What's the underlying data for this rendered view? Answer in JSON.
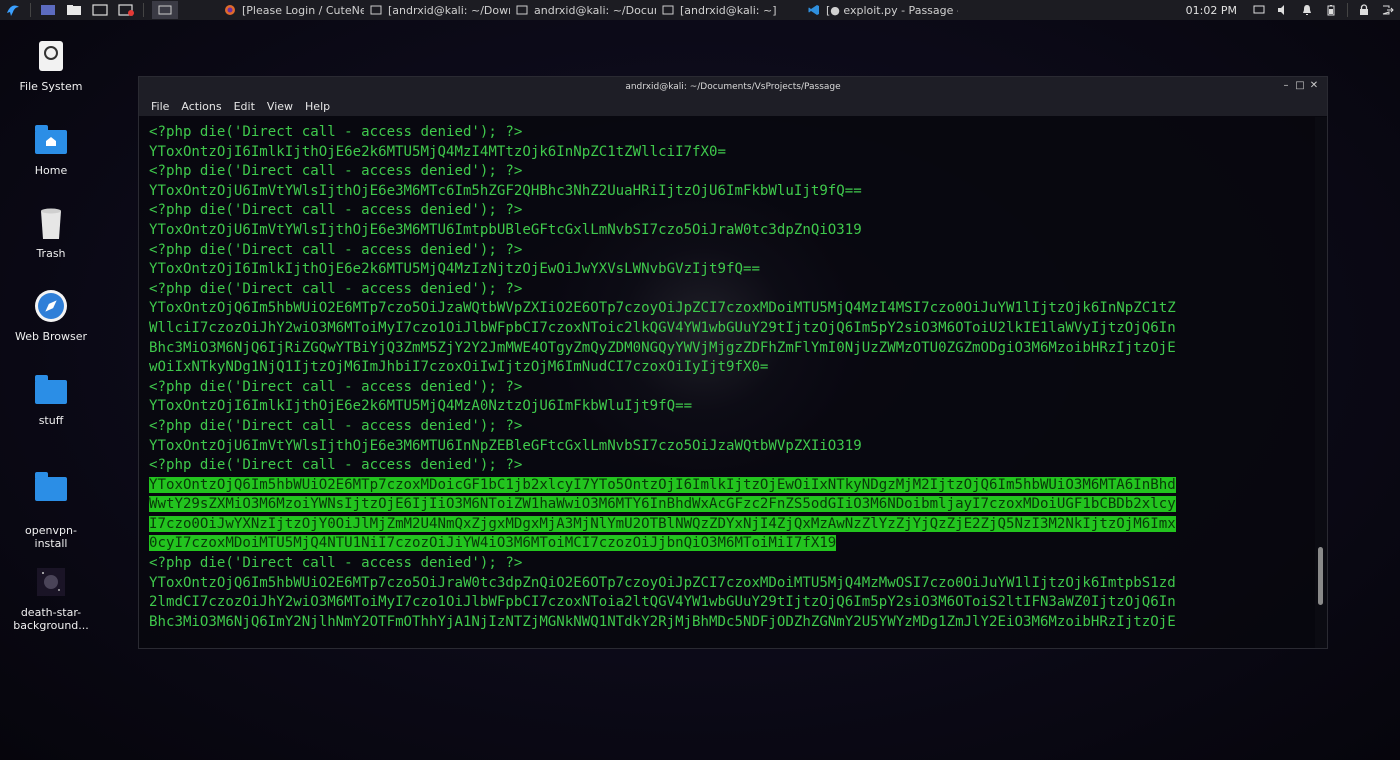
{
  "taskbar": {
    "tasks": [
      {
        "icon": "firefox-icon",
        "label": "[Please Login / CuteNew..."
      },
      {
        "icon": "terminal-icon",
        "label": "[andrxid@kali: ~/Downl..."
      },
      {
        "icon": "terminal-icon",
        "label": "andrxid@kali: ~/Docum..."
      },
      {
        "icon": "terminal-icon",
        "label": "[andrxid@kali: ~]"
      },
      {
        "icon": "vscode-icon",
        "label": "[● exploit.py - Passage - ..."
      }
    ],
    "clock": "01:02 PM"
  },
  "desktop": {
    "icons": [
      {
        "name": "File System",
        "icon": "drive-icon"
      },
      {
        "name": "Home",
        "icon": "home-folder-icon"
      },
      {
        "name": "Trash",
        "icon": "trash-icon"
      },
      {
        "name": "Web Browser",
        "icon": "compass-icon"
      },
      {
        "name": "stuff",
        "icon": "folder-icon"
      },
      {
        "name": "openvpn-\ninstall",
        "icon": "folder-icon"
      },
      {
        "name": "death-star-\nbackground...",
        "icon": "image-thumbnail-icon"
      }
    ]
  },
  "terminal": {
    "title": "andrxid@kali: ~/Documents/VsProjects/Passage",
    "menu": [
      "File",
      "Actions",
      "Edit",
      "View",
      "Help"
    ],
    "lines": [
      "<?php die('Direct call - access denied'); ?>",
      "YToxOntzOjI6ImlkIjthOjE6e2k6MTU5MjQ4MzI4MTtzOjk6InNpZC1tZWllciI7fX0=",
      "<?php die('Direct call - access denied'); ?>",
      "YToxOntzOjU6ImVtYWlsIjthOjE6e3M6MTc6Im5hZGF2QHBhc3NhZ2UuaHRiIjtzOjU6ImFkbWluIjt9fQ==",
      "<?php die('Direct call - access denied'); ?>",
      "YToxOntzOjU6ImVtYWlsIjthOjE6e3M6MTU6ImtpbUBleGFtcGxlLmNvbSI7czo5OiJraW0tc3dpZnQiO319",
      "<?php die('Direct call - access denied'); ?>",
      "YToxOntzOjI6ImlkIjthOjE6e2k6MTU5MjQ4MzIzNjtzOjEwOiJwYXVsLWNvbGVzIjt9fQ==",
      "<?php die('Direct call - access denied'); ?>",
      "YToxOntzOjQ6Im5hbWUiO2E6MTp7czo5OiJzaWQtbWVpZXIiO2E6OTp7czoyOiJpZCI7czoxMDoiMTU5MjQ4MzI4MSI7czo0OiJuYW1lIjtzOjk6InNpZC1tZ",
      "WllciI7czozOiJhY2wiO3M6MToiMyI7czo1OiJlbWFpbCI7czoxNToic2lkQGV4YW1wbGUuY29tIjtzOjQ6Im5pY2siO3M6OToiU2lkIE1laWVyIjtzOjQ6In",
      "Bhc3MiO3M6NjQ6IjRiZGQwYTBiYjQ3ZmM5ZjY2Y2JmMWE4OTgyZmQyZDM0NGQyYWVjMjgzZDFhZmFlYmI0NjUzZWMzOTU0ZGZmODgiO3M6MzoibHRzIjtzOjE",
      "wOiIxNTkyNDg1NjQ1IjtzOjM6ImJhbiI7czoxOiIwIjtzOjM6ImNudCI7czoxOiIyIjt9fX0=",
      "<?php die('Direct call - access denied'); ?>",
      "YToxOntzOjI6ImlkIjthOjE6e2k6MTU5MjQ4MzA0NztzOjU6ImFkbWluIjt9fQ==",
      "<?php die('Direct call - access denied'); ?>",
      "YToxOntzOjU6ImVtYWlsIjthOjE6e3M6MTU6InNpZEBleGFtcGxlLmNvbSI7czo5OiJzaWQtbWVpZXIiO319",
      "<?php die('Direct call - access denied'); ?>"
    ],
    "selected_lines": [
      "YToxOntzOjQ6Im5hbWUiO2E6MTp7czoxMDoicGF1bC1jb2xlcyI7YTo5OntzOjI6ImlkIjtzOjEwOiIxNTkyNDgzMjM2IjtzOjQ6Im5hbWUiO3M6MTA6InBhd",
      "WwtY29sZXMiO3M6MzoiYWNsIjtzOjE6IjIiO3M6NToiZW1haWwiO3M6MTY6InBhdWxAcGFzc2FnZS5odGIiO3M6NDoibmljayI7czoxMDoiUGF1bCBDb2xlcy",
      "I7czo0OiJwYXNzIjtzOjY0OiJlMjZmM2U4NmQxZjgxMDgxMjA3MjNlYmU2OTBlNWQzZDYxNjI4ZjQxMzAwNzZlYzZjYjQzZjE2ZjQ5NzI3M2NkIjtzOjM6Imx",
      "0cyI7czoxMDoiMTU5MjQ4NTU1NiI7czozOiJiYW4iO3M6MToiMCI7czozOiJjbnQiO3M6MToiMiI7fX19"
    ],
    "after_lines": [
      "<?php die('Direct call - access denied'); ?>",
      "YToxOntzOjQ6Im5hbWUiO2E6MTp7czo5OiJraW0tc3dpZnQiO2E6OTp7czoyOiJpZCI7czoxMDoiMTU5MjQ4MzMwOSI7czo0OiJuYW1lIjtzOjk6ImtpbS1zd",
      "2lmdCI7czozOiJhY2wiO3M6MToiMyI7czo1OiJlbWFpbCI7czoxNToia2ltQGV4YW1wbGUuY29tIjtzOjQ6Im5pY2siO3M6OToiS2ltIFN3aWZ0IjtzOjQ6In",
      "Bhc3MiO3M6NjQ6ImY2NjlhNmY2OTFmOThhYjA1NjIzNTZjMGNkNWQ1NTdkY2RjMjBhMDc5NDFjODZhZGNmY2U5YWYzMDg1ZmJlY2EiO3M6MzoibHRzIjtzOjE"
    ]
  },
  "colors": {
    "terminal_text": "#3fc94c",
    "selection_bg": "#23c41f",
    "panel_bg": "#1c1c22"
  }
}
